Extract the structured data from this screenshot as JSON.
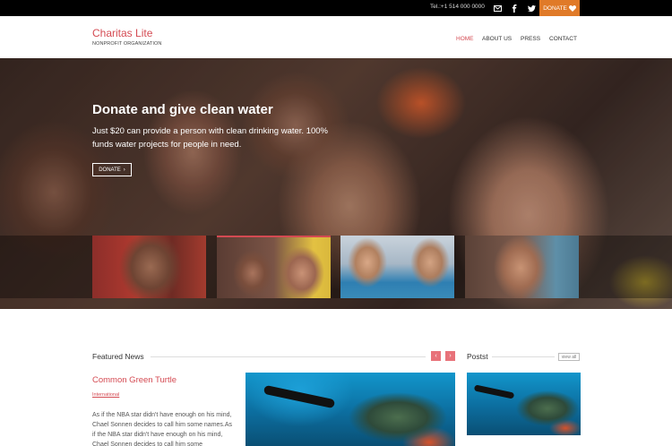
{
  "topbar": {
    "tel": "Tel.:+1 514 000 0000",
    "icons": [
      "envelope-icon",
      "facebook-icon",
      "twitter-icon"
    ],
    "donate_label": "DONATE"
  },
  "header": {
    "brand": "Charitas Lite",
    "tagline": "NONPROFIT ORGANIZATION",
    "nav": [
      "HOME",
      "ABOUT US",
      "PRESS",
      "CONTACT"
    ],
    "active_nav": "HOME"
  },
  "hero": {
    "title": "Donate and give clean water",
    "text": "Just $20 can provide a person with clean drinking water. 100% funds water projects for people in need.",
    "button_label": "DONATE"
  },
  "featured": {
    "title": "Featured News",
    "article": {
      "title": "Common Green Turtle",
      "category": "International",
      "excerpt": "As if the NBA star didn't have enough on his mind, Chael Sonnen decides to call him some names.As if the NBA star didn't have enough on his mind, Chael Sonnen decides to call him some"
    }
  },
  "posts": {
    "title": "Postst",
    "view_all": "view all"
  },
  "colors": {
    "accent": "#d44a52",
    "donate": "#e07a28",
    "topbar": "#000000"
  }
}
